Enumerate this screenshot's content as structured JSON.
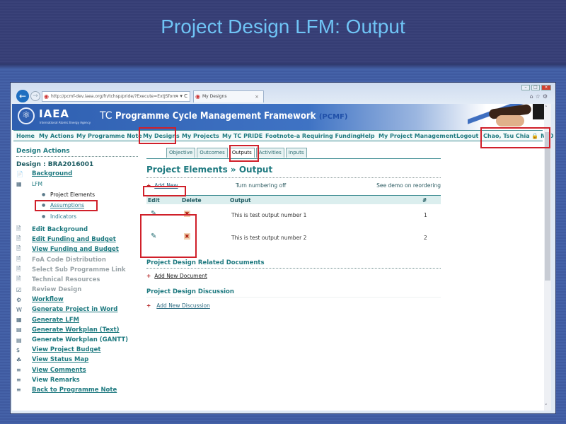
{
  "slide": {
    "title": "Project Design LFM: Output"
  },
  "browser": {
    "address": "http://pcmf-dev.iaea.org/fn/tchsp/pride/?Execute=ExtJSform",
    "address_actions": "⌕ ▾ C",
    "tab_title": "My Designs",
    "tab_close": "×",
    "back_icon": "←",
    "forward_icon": "→",
    "window_controls": {
      "minimize": "–",
      "maximize": "□",
      "close": "×"
    },
    "toolbar_icons": "⌂☆⚙"
  },
  "banner": {
    "org": "IAEA",
    "org_sub": "International Atomic Energy Agency",
    "title_prefix": "TC",
    "title_main": "Programme Cycle Management Framework",
    "title_abbr": "(PCMF)"
  },
  "nav": {
    "items": [
      {
        "label": "Home"
      },
      {
        "label": "My Actions"
      },
      {
        "label": "My Programme Note"
      },
      {
        "label": "My Designs"
      },
      {
        "label": "My Projects"
      },
      {
        "label": "My TC PRIDE"
      },
      {
        "label": "Footnote-a Requiring Funding"
      },
      {
        "label": "Help"
      },
      {
        "label": "My Project Management"
      },
      {
        "label": "Logout"
      }
    ],
    "user": "Chao, Tsu Chia 🔒 NLO"
  },
  "sidebar": {
    "heading": "Design Actions",
    "design_id": "Design : BRA2016001",
    "background": {
      "label": "Background",
      "icon": "📄"
    },
    "lfm": {
      "label": "LFM",
      "icon": "▦"
    },
    "lfm_items": [
      {
        "label": "Project Elements"
      },
      {
        "label": "Assumptions"
      },
      {
        "label": "Indicators"
      }
    ],
    "actions": [
      {
        "label": "Edit Background",
        "icon": "🗎"
      },
      {
        "label": "Edit Funding and Budget",
        "icon": "🗎"
      },
      {
        "label": "View Funding and Budget",
        "icon": "🗎"
      },
      {
        "label": "FoA Code Distribution",
        "icon": "🗎"
      },
      {
        "label": "Select Sub Programme Link",
        "icon": "🗎"
      },
      {
        "label": "Technical Resources",
        "icon": "🗎"
      },
      {
        "label": "Review Design",
        "icon": "☑"
      },
      {
        "label": "Workflow",
        "icon": "⚙"
      },
      {
        "label": "Generate Project in Word",
        "icon": "W"
      },
      {
        "label": "Generate LFM",
        "icon": "▦"
      },
      {
        "label": "Generate Workplan (Text)",
        "icon": "▤"
      },
      {
        "label": "Generate Workplan (GANTT)",
        "icon": "▤"
      },
      {
        "label": "View Project Budget",
        "icon": "$"
      },
      {
        "label": "View Status Map",
        "icon": "☘"
      },
      {
        "label": "View Comments",
        "icon": "≡"
      },
      {
        "label": "View Remarks",
        "icon": "≡"
      },
      {
        "label": "Back to Programme Note",
        "icon": "≡"
      }
    ]
  },
  "main": {
    "tabs": [
      {
        "label": "Objective"
      },
      {
        "label": "Outcomes"
      },
      {
        "label": "Outputs"
      },
      {
        "label": "Activities"
      },
      {
        "label": "Inputs"
      }
    ],
    "title": "Project Elements » Output",
    "add_new": "Add New",
    "plus": "+",
    "numbering": "Turn numbering off",
    "demo": "See demo on reordering",
    "table": {
      "headers": {
        "edit": "Edit",
        "delete": "Delete",
        "output": "Output",
        "num": "#"
      },
      "edit_icon": "✎",
      "delete_icon": "✖",
      "rows": [
        {
          "output": "This is test output number 1",
          "num": "1"
        },
        {
          "output": "This is test output number 2",
          "num": "2"
        }
      ]
    },
    "documents": {
      "title": "Project Design Related Documents",
      "add": "Add New Document"
    },
    "discussion": {
      "title": "Project Design Discussion",
      "add": "Add New Discussion"
    }
  },
  "scrollbar": {
    "up": "˄",
    "down": "˅"
  }
}
